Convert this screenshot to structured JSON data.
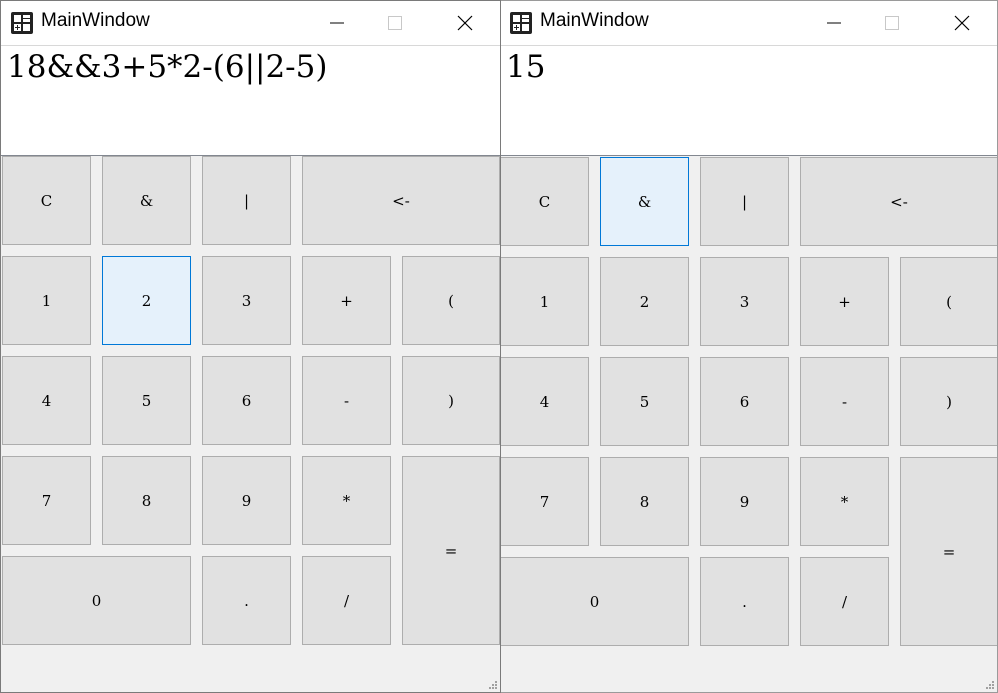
{
  "left_window": {
    "title": "MainWindow",
    "display": "18&&3+5*2-(6||2-5)",
    "buttons": {
      "clear": "C",
      "and": "&",
      "or": "|",
      "backspace": "<-",
      "d1": "1",
      "d2": "2",
      "d3": "3",
      "plus": "+",
      "lparen": "(",
      "d4": "4",
      "d5": "5",
      "d6": "6",
      "minus": "-",
      "rparen": ")",
      "d7": "7",
      "d8": "8",
      "d9": "9",
      "mul": "*",
      "equals": "=",
      "d0": "0",
      "dot": ".",
      "div": "/"
    },
    "highlighted_button": "2"
  },
  "right_window": {
    "title": "MainWindow",
    "display": "15",
    "buttons": {
      "clear": "C",
      "and": "&",
      "or": "|",
      "backspace": "<-",
      "d1": "1",
      "d2": "2",
      "d3": "3",
      "plus": "+",
      "lparen": "(",
      "d4": "4",
      "d5": "5",
      "d6": "6",
      "minus": "-",
      "rparen": ")",
      "d7": "7",
      "d8": "8",
      "d9": "9",
      "mul": "*",
      "equals": "=",
      "d0": "0",
      "dot": ".",
      "div": "/"
    },
    "highlighted_button": "&"
  },
  "icons": {
    "app": "calculator-icon",
    "minimize": "minimize-icon",
    "maximize": "maximize-icon",
    "close": "close-icon",
    "resize": "resize-grip-icon"
  },
  "colors": {
    "button_face": "#e1e1e1",
    "button_border": "#adadad",
    "highlight_face": "#e5f1fb",
    "highlight_border": "#0078d7",
    "window_bg": "#f0f0f0"
  }
}
